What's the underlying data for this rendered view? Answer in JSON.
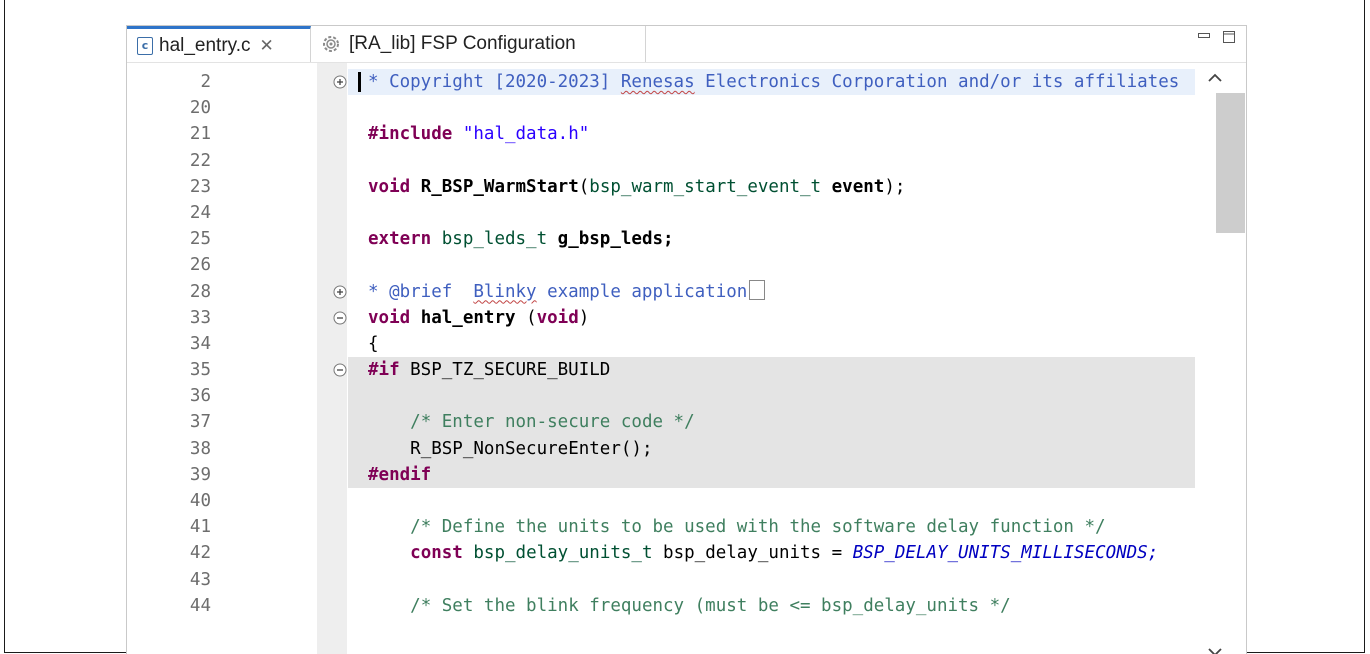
{
  "tabs": [
    {
      "label": "hal_entry.c",
      "icon": "c-file-icon",
      "active": true
    },
    {
      "label": "[RA_lib] FSP Configuration",
      "icon": "gear-icon",
      "active": false
    }
  ],
  "file_icon_letter": "c",
  "line_numbers": [
    "2",
    "20",
    "21",
    "22",
    "23",
    "24",
    "25",
    "26",
    "28",
    "33",
    "34",
    "35",
    "36",
    "37",
    "38",
    "39",
    "40",
    "41",
    "42",
    "43",
    "44"
  ],
  "code": {
    "l2": {
      "text": "* Copyright [2020-2023] ",
      "squiggle": "Renesas",
      "rest": " Electronics Corporation and/or its affiliates"
    },
    "l21": {
      "pp": "#include",
      "str": "\"hal_data.h\""
    },
    "l23": {
      "kw": "void",
      "fn": "R_BSP_WarmStart",
      "open": "(",
      "type": "bsp_warm_start_event_t",
      "param": " event",
      "close": ");"
    },
    "l25": {
      "kw": "extern",
      "type": "bsp_leds_t",
      "name": " g_bsp_leds;"
    },
    "l28": {
      "prefix": "* @brief  ",
      "squiggle": "Blinky",
      "rest": " example application"
    },
    "l33": {
      "kw": "void",
      "fn": "hal_entry",
      "open": " (",
      "kw2": "void",
      "close": ")"
    },
    "l34": {
      "text": "{"
    },
    "l35": {
      "pp": "#if",
      "rest": " BSP_TZ_SECURE_BUILD"
    },
    "l37": {
      "com": "/* Enter non-secure code */"
    },
    "l38": {
      "text": "R_BSP_NonSecureEnter();"
    },
    "l39": {
      "pp": "#endif"
    },
    "l41": {
      "com": "/* Define the units to be used with the software delay function */"
    },
    "l42": {
      "kw": "const",
      "type": "bsp_delay_units_t",
      "name": " bsp_delay_units = ",
      "macro": "BSP_DELAY_UNITS_MILLISECONDS;"
    },
    "l44": {
      "com": "/* Set the blink frequency (must be <= bsp_delay_units */"
    }
  },
  "colors": {
    "tab_accent": "#2e74c9",
    "keyword": "#7f0055",
    "comment": "#3f7f5f",
    "doc": "#3f5fbf",
    "string": "#2a00ff",
    "macro": "#0000c0"
  }
}
